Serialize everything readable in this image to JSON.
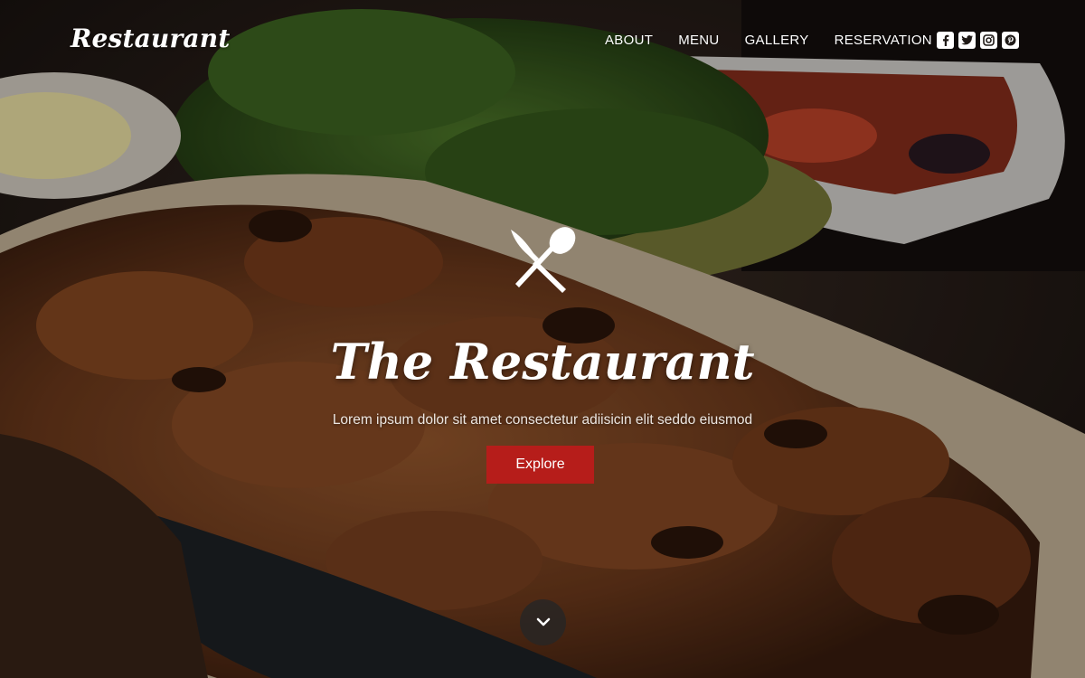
{
  "brand": {
    "logo_text": "Restaurant"
  },
  "nav": {
    "items": [
      {
        "label": "ABOUT"
      },
      {
        "label": "MENU"
      },
      {
        "label": "GALLERY"
      },
      {
        "label": "RESERVATION"
      }
    ]
  },
  "social": {
    "icons": [
      "facebook-icon",
      "twitter-icon",
      "instagram-icon",
      "pinterest-icon"
    ]
  },
  "hero": {
    "icon": "utensils-cross-icon",
    "title": "The Restaurant",
    "subtitle": "Lorem ipsum dolor sit amet consectetur adiisicin elit seddo eiusmod",
    "cta_label": "Explore",
    "scroll_icon": "chevron-down-icon"
  },
  "colors": {
    "accent": "#b61d1a",
    "text": "#ffffff"
  }
}
